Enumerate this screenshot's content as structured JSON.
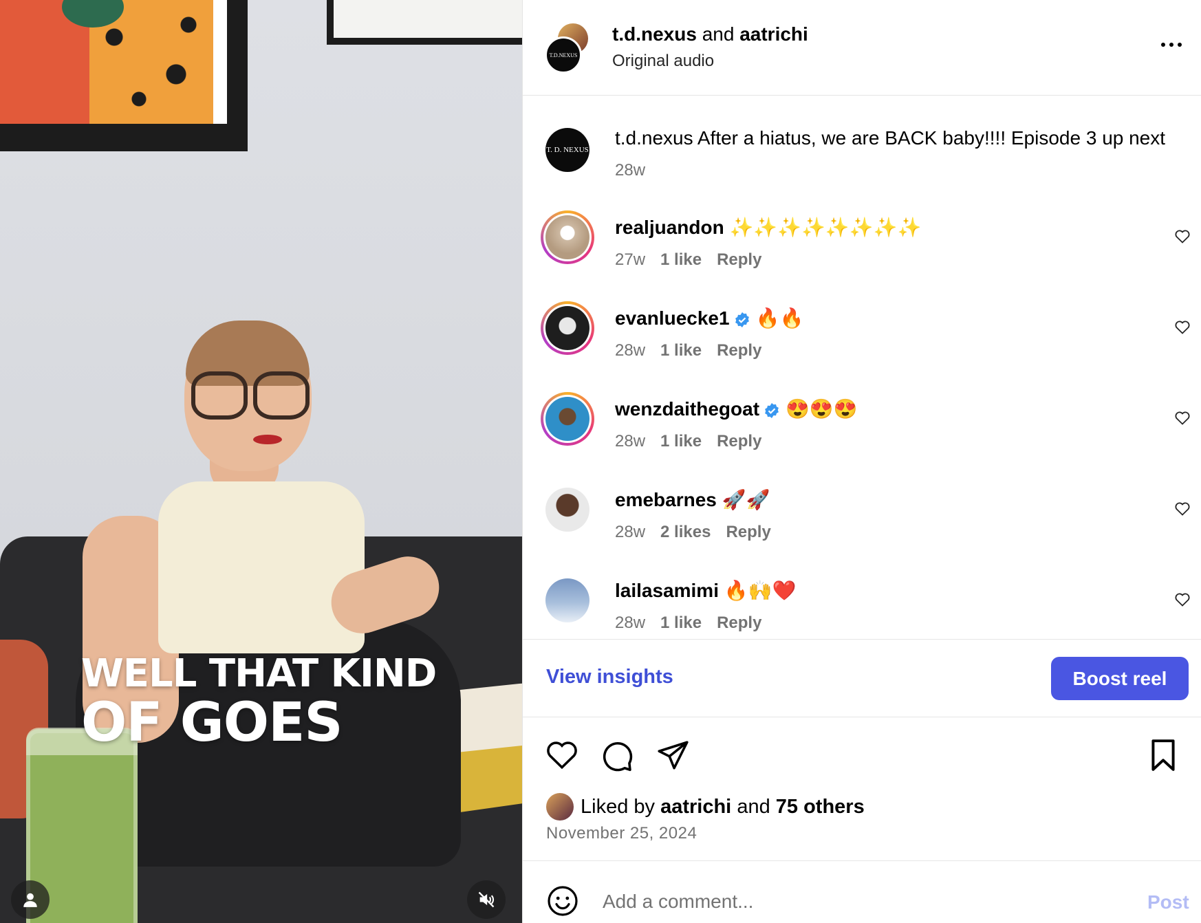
{
  "video": {
    "caption_line1": "WELL THAT KIND",
    "caption_line2": "OF GOES"
  },
  "header": {
    "author1": "t.d.nexus",
    "connector": " and ",
    "author2": "aatrichi",
    "subtitle": "Original audio",
    "avatar_text": "T.D.NEXUS"
  },
  "post": {
    "username": "t.d.nexus",
    "caption": " After a hiatus, we are BACK baby!!!! Episode 3 up next",
    "age": "28w",
    "avatar_text": "T. D. NEXUS"
  },
  "comments": [
    {
      "username": "realjuandon",
      "verified": false,
      "text": " ✨✨✨✨✨✨✨✨",
      "age": "27w",
      "likes": "1 like",
      "reply": "Reply",
      "ring": true,
      "avatar_color": "#c9b49a"
    },
    {
      "username": "evanluecke1",
      "verified": true,
      "text": "🔥🔥",
      "age": "28w",
      "likes": "1 like",
      "reply": "Reply",
      "ring": true,
      "avatar_color": "#2a2a2a"
    },
    {
      "username": "wenzdaithegoat",
      "verified": true,
      "text": "😍😍😍",
      "age": "28w",
      "likes": "1 like",
      "reply": "Reply",
      "ring": true,
      "avatar_color": "#2a8ac0"
    },
    {
      "username": "emebarnes",
      "verified": false,
      "text": " 🚀🚀",
      "age": "28w",
      "likes": "2 likes",
      "reply": "Reply",
      "ring": false,
      "avatar_color": "#3a3a3a"
    },
    {
      "username": "lailasamimi",
      "verified": false,
      "text": " 🔥🙌❤️",
      "age": "28w",
      "likes": "1 like",
      "reply": "Reply",
      "ring": false,
      "avatar_color": "#8fa8c8"
    }
  ],
  "cta": {
    "insights": "View insights",
    "boost": "Boost reel"
  },
  "likes": {
    "prefix": "Liked by ",
    "user": "aatrichi",
    "middle": " and ",
    "others": "75 others",
    "date": "November 25, 2024"
  },
  "composer": {
    "placeholder": "Add a comment...",
    "post_label": "Post"
  },
  "colors": {
    "accent": "#4a56e2",
    "link": "#3f4fd6",
    "muted": "#737373",
    "post_disabled": "#b3bcf5"
  }
}
